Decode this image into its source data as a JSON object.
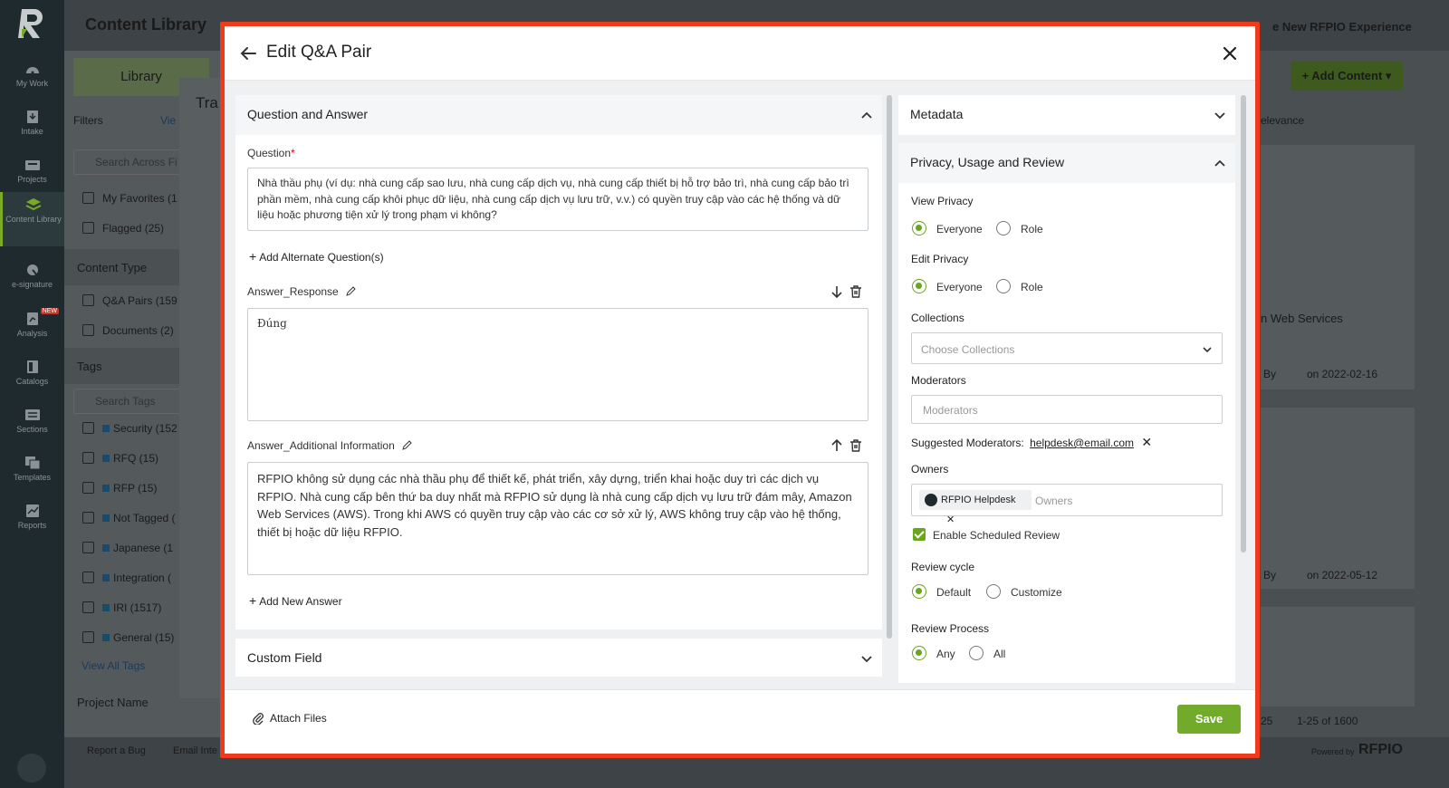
{
  "rail": {
    "items": [
      {
        "label": "My Work",
        "icon": "gauge-icon"
      },
      {
        "label": "Intake",
        "icon": "inbox-icon"
      },
      {
        "label": "Projects",
        "icon": "folder-icon"
      },
      {
        "label": "Content Library",
        "icon": "library-icon"
      },
      {
        "label": "e-signature",
        "icon": "signature-icon"
      },
      {
        "label": "Analysis",
        "icon": "analysis-icon",
        "badge": "NEW"
      },
      {
        "label": "Catalogs",
        "icon": "catalog-icon"
      },
      {
        "label": "Sections",
        "icon": "sections-icon"
      },
      {
        "label": "Templates",
        "icon": "templates-icon"
      },
      {
        "label": "Reports",
        "icon": "reports-icon"
      }
    ]
  },
  "background": {
    "title": "Content Library",
    "new_experience": "e New RFPIO Experience",
    "tab": "Library",
    "filters": "Filters",
    "view": "Vie",
    "search_all": "Search Across Fi",
    "favorites": "My Favorites (1",
    "flagged": "Flagged (25)",
    "content_type": "Content Type",
    "qa_pairs": "Q&A Pairs (159",
    "documents": "Documents (2)",
    "tags": "Tags",
    "search_tags": "Search Tags",
    "tag_items": [
      "Security (152",
      "RFQ (15)",
      "RFP (15)",
      "Not Tagged (",
      "Japanese (1",
      "Integration (",
      "IRI (1517)",
      "General (15)"
    ],
    "view_all_tags": "View All Tags",
    "project_name": "Project Name",
    "add_content": "Add Content",
    "relevance": "elevance",
    "web_services": "n Web Services",
    "by": "By",
    "date1": "on 2022-02-16",
    "date2": "on 2022-05-12",
    "pagination": "1-25 of 1600",
    "page_size": "25",
    "report_bug": "Report a Bug",
    "email_int": "Email Inte",
    "powered_by": "Powered by",
    "brand": "RFPIO",
    "tra": "Tra"
  },
  "modal": {
    "title": "Edit Q&A Pair",
    "qa_section": {
      "title": "Question and Answer",
      "question_label": "Question",
      "required_mark": "*",
      "question_text": "Nhà thầu phụ (ví dụ: nhà cung cấp sao lưu, nhà cung cấp dịch vụ, nhà cung cấp thiết bị hỗ trợ bảo trì, nhà cung cấp bảo trì phần mềm, nhà cung cấp khôi phục dữ liệu, nhà cung cấp dịch vụ lưu trữ, v.v.) có quyền truy cập vào các hệ thống và dữ liệu hoặc phương tiện xử lý trong phạm vi không?",
      "add_alternate": "Add Alternate Question(s)",
      "answer_response_label": "Answer_Response",
      "answer_response_text": "Đúng",
      "answer_additional_label": "Answer_Additional Information",
      "answer_additional_text": "RFPIO không sử dụng các nhà thầu phụ để thiết kế, phát triển, xây dựng, triển khai hoặc duy trì các dịch vụ RFPIO. Nhà cung cấp bên thứ ba duy nhất mà RFPIO sử dụng là nhà cung cấp dịch vụ lưu trữ đám mây, Amazon Web Services (AWS). Trong khi AWS có quyền truy cập vào các cơ sở xử lý, AWS không truy cập vào hệ thống, thiết bị hoặc dữ liệu RFPIO.",
      "add_new_answer": "Add New Answer"
    },
    "custom_field": "Custom Field",
    "metadata": "Metadata",
    "privacy": {
      "title": "Privacy, Usage and Review",
      "view_privacy": "View Privacy",
      "edit_privacy": "Edit Privacy",
      "everyone": "Everyone",
      "role": "Role",
      "collections": "Collections",
      "collections_placeholder": "Choose Collections",
      "moderators": "Moderators",
      "moderators_placeholder": "Moderators",
      "suggested_label": "Suggested Moderators:",
      "suggested_email": "helpdesk@email.com",
      "owners": "Owners",
      "owner_chip": "RFPIO Helpdesk",
      "owners_placeholder": "Owners",
      "enable_review": "Enable Scheduled Review",
      "review_cycle": "Review cycle",
      "default": "Default",
      "customize": "Customize",
      "review_process": "Review Process",
      "any": "Any",
      "all": "All"
    },
    "footer": {
      "attach": "Attach Files",
      "save": "Save"
    }
  },
  "colors": {
    "accent": "#72ab2c",
    "highlight": "#f03a1c",
    "rail": "#1f2a2e"
  }
}
